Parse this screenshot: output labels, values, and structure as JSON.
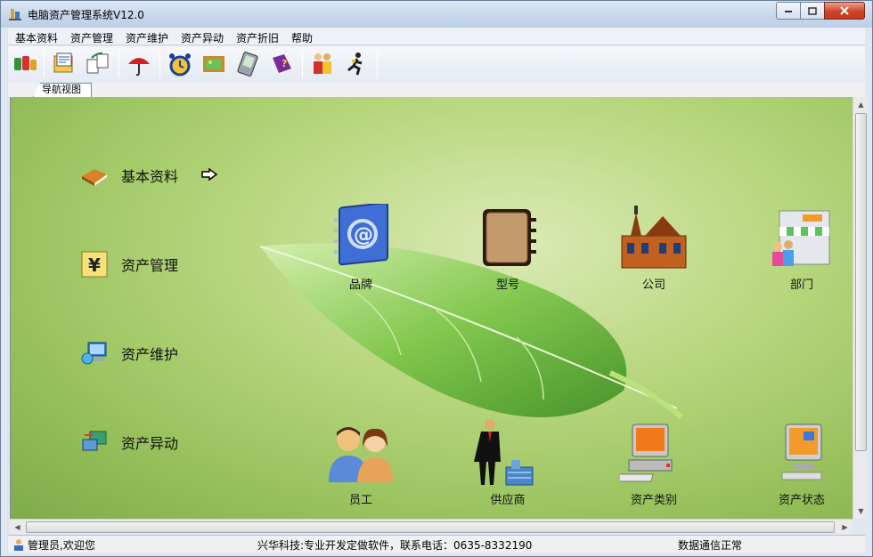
{
  "window": {
    "title": "电脑资产管理系统V12.0"
  },
  "menu": [
    "基本资料",
    "资产管理",
    "资产维护",
    "资产异动",
    "资产折旧",
    "帮助"
  ],
  "tabs": {
    "nav_view": "导航视图"
  },
  "nav": [
    {
      "label": "基本资料",
      "icon": "book-icon"
    },
    {
      "label": "资产管理",
      "icon": "yen-icon"
    },
    {
      "label": "资产维护",
      "icon": "computer-maintenance-icon"
    },
    {
      "label": "资产异动",
      "icon": "computer-transfer-icon"
    }
  ],
  "tiles": [
    {
      "label": "品牌",
      "icon": "address-book-icon"
    },
    {
      "label": "型号",
      "icon": "notebook-icon"
    },
    {
      "label": "公司",
      "icon": "building-icon"
    },
    {
      "label": "部门",
      "icon": "store-icon"
    },
    {
      "label": "员工",
      "icon": "people-icon"
    },
    {
      "label": "供应商",
      "icon": "businessman-icon"
    },
    {
      "label": "资产类别",
      "icon": "computer-icon"
    },
    {
      "label": "资产状态",
      "icon": "monitor-icon"
    }
  ],
  "status": {
    "user": "管理员,欢迎您",
    "vendor": "兴华科技:专业开发定做软件，联系电话：0635-8332190",
    "connection": "数据通信正常"
  },
  "colors": {
    "accent": "#8dbb55",
    "title_bar": "#c9d9ec",
    "close_button": "#c9452a"
  }
}
